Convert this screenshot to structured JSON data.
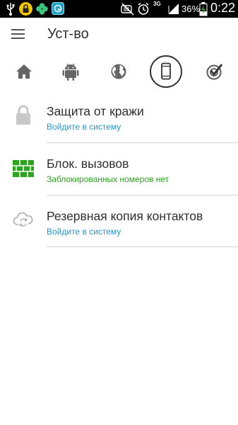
{
  "status_bar": {
    "network": "3G",
    "battery_percent": "36%",
    "battery_level": 0.36,
    "time": "0:22",
    "icons": [
      "usb-icon",
      "lock-app-icon",
      "clover-icon",
      "app-icon",
      "mute-icon",
      "alarm-icon",
      "signal-icon",
      "battery-charging-icon"
    ]
  },
  "header": {
    "title": "Уст-во"
  },
  "tabs": [
    {
      "icon": "home-icon",
      "selected": false
    },
    {
      "icon": "android-icon",
      "selected": false
    },
    {
      "icon": "globe-icon",
      "selected": false
    },
    {
      "icon": "phone-icon",
      "selected": true
    },
    {
      "icon": "checkmark-target-icon",
      "selected": false
    }
  ],
  "items": [
    {
      "icon": "padlock-icon",
      "title": "Защита от кражи",
      "subtitle": "Войдите в систему",
      "subtitle_color": "#1a9ad6"
    },
    {
      "icon": "brick-wall-icon",
      "title": "Блок. вызовов",
      "subtitle": "Заблокированных номеров нет",
      "subtitle_color": "#2ea31f"
    },
    {
      "icon": "cloud-sync-icon",
      "title": "Резервная копия контактов",
      "subtitle": "Войдите в систему",
      "subtitle_color": "#1a9ad6"
    }
  ],
  "colors": {
    "accent_blue": "#1a9ad6",
    "accent_green": "#2ea31f",
    "selected_ring": "#333333",
    "icon_gray": "#666666"
  }
}
